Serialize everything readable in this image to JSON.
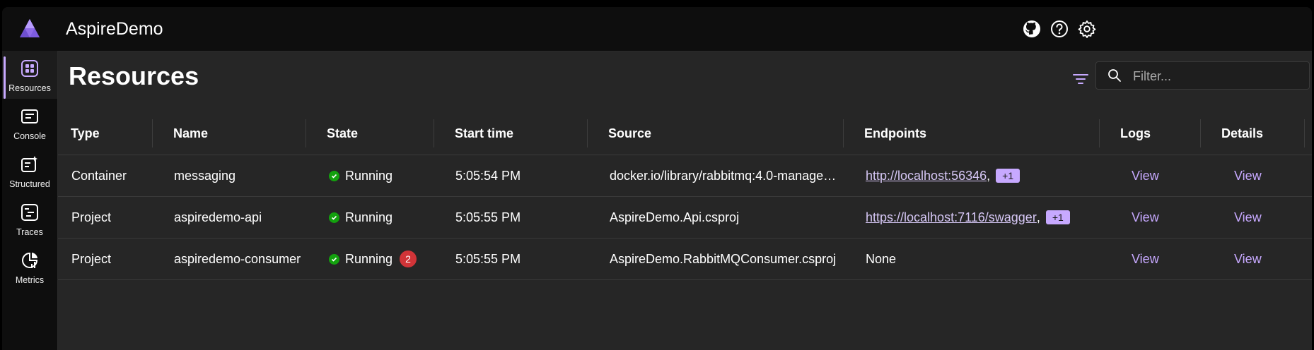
{
  "app": {
    "title": "AspireDemo"
  },
  "header": {
    "icons": [
      "github-icon",
      "help-icon",
      "settings-icon"
    ]
  },
  "sidebar": {
    "items": [
      {
        "label": "Resources",
        "icon": "resources-icon",
        "active": true
      },
      {
        "label": "Console",
        "icon": "console-icon",
        "active": false
      },
      {
        "label": "Structured",
        "icon": "structured-icon",
        "active": false
      },
      {
        "label": "Traces",
        "icon": "traces-icon",
        "active": false
      },
      {
        "label": "Metrics",
        "icon": "metrics-icon",
        "active": false
      }
    ]
  },
  "page": {
    "title": "Resources",
    "filter": {
      "placeholder": "Filter...",
      "value": ""
    }
  },
  "table": {
    "columns": [
      "Type",
      "Name",
      "State",
      "Start time",
      "Source",
      "Endpoints",
      "Logs",
      "Details"
    ],
    "rows": [
      {
        "type": "Container",
        "name": "messaging",
        "state": "Running",
        "errors": "",
        "start_time": "5:05:54 PM",
        "source": "docker.io/library/rabbitmq:4.0-manage…",
        "endpoint": "http://localhost:56346",
        "endpoint_extra": "+1",
        "logs": "View",
        "details": "View"
      },
      {
        "type": "Project",
        "name": "aspiredemo-api",
        "state": "Running",
        "errors": "",
        "start_time": "5:05:55 PM",
        "source": "AspireDemo.Api.csproj",
        "endpoint": "https://localhost:7116/swagger",
        "endpoint_extra": "+1",
        "logs": "View",
        "details": "View"
      },
      {
        "type": "Project",
        "name": "aspiredemo-consumer",
        "state": "Running",
        "errors": "2",
        "start_time": "5:05:55 PM",
        "source": "AspireDemo.RabbitMQConsumer.csproj",
        "endpoint": "None",
        "endpoint_extra": "",
        "logs": "View",
        "details": "View"
      }
    ]
  },
  "colors": {
    "accent": "#c7a9ff",
    "running": "#13a10e",
    "error": "#d13438",
    "background": "#262626"
  }
}
